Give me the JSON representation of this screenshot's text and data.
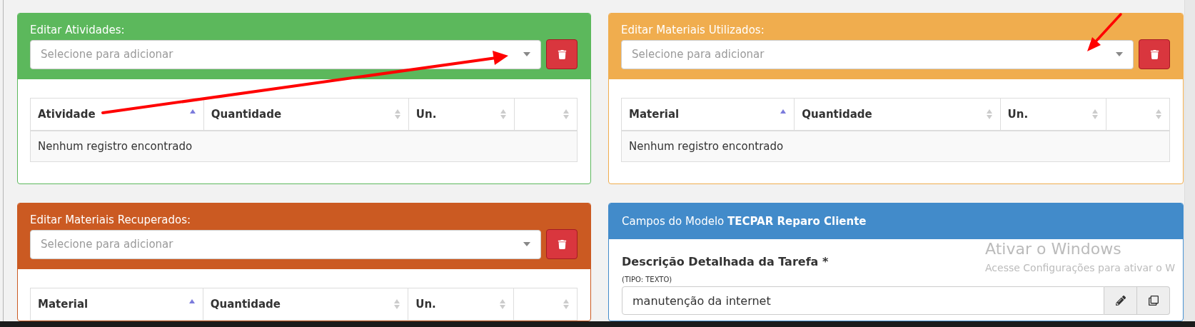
{
  "panels": [
    {
      "kind": "select",
      "color": "#5cb85c",
      "title": "Editar Atividades:",
      "placeholder": "Selecione para adicionar",
      "columns": [
        {
          "label": "Atividade",
          "sorted": true
        },
        {
          "label": "Quantidade",
          "sorted": false
        },
        {
          "label": "Un.",
          "sorted": false
        },
        {
          "sorted": false
        }
      ],
      "empty_message": "Nenhum registro encontrado"
    },
    {
      "kind": "select",
      "color": "#f0ad4e",
      "title": "Editar Materiais Utilizados:",
      "placeholder": "Selecione para adicionar",
      "columns": [
        {
          "label": "Material",
          "sorted": true
        },
        {
          "label": "Quantidade",
          "sorted": false
        },
        {
          "label": "Un.",
          "sorted": false
        },
        {
          "sorted": false
        }
      ],
      "empty_message": "Nenhum registro encontrado"
    },
    {
      "kind": "select",
      "color": "#cb5a22",
      "title": "Editar Materiais Recuperados:",
      "placeholder": "Selecione para adicionar",
      "columns": [
        {
          "label": "Material",
          "sorted": true
        },
        {
          "label": "Quantidade",
          "sorted": false
        },
        {
          "label": "Un.",
          "sorted": false
        },
        {
          "sorted": false
        }
      ]
    },
    {
      "kind": "fields",
      "color": "#428bca",
      "title": "Campos do Modelo **TECPAR Reparo Cliente**",
      "fields": [
        {
          "label": "Descrição Detalhada da Tarefa *",
          "note": "(TIPO: TEXTO)",
          "value": "manutenção da internet"
        }
      ]
    }
  ],
  "watermark": {
    "title": "Ativar o Windows",
    "text": "Acesse Configurações para ativar o W"
  }
}
